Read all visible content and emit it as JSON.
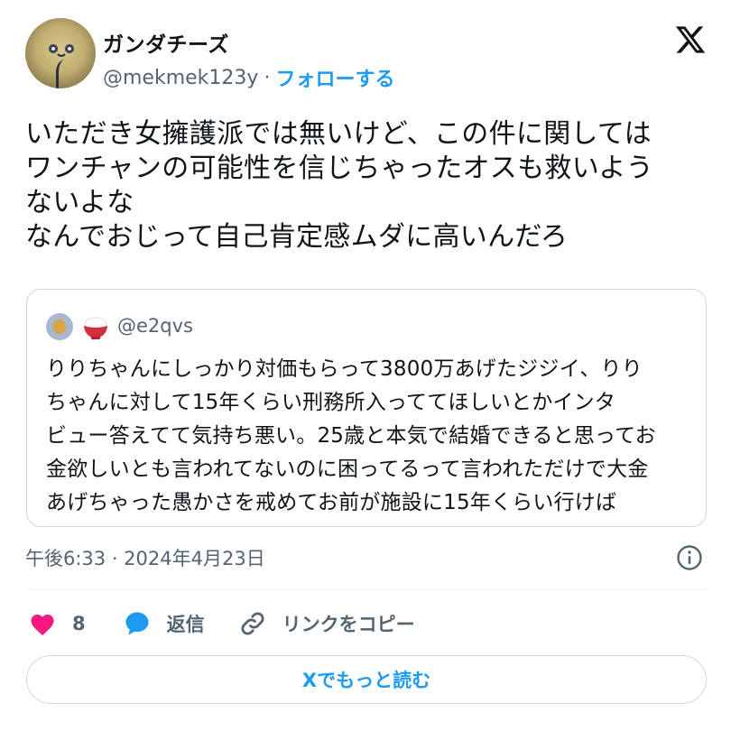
{
  "author": {
    "display_name": "ガンダチーズ",
    "handle": "@mekmek123y",
    "separator": "·",
    "follow_label": "フォローする"
  },
  "tweet": {
    "text": "いただき女擁護派では無いけど、この件に関しては\nワンチャンの可能性を信じちゃったオスも救いよう\nないよな\nなんでおじって自己肯定感ムダに高いんだろ"
  },
  "quote": {
    "handle": "@e2qvs",
    "text": "りりちゃんにしっかり対価もらって3800万あげたジジイ、りり\nちゃんに対して15年くらい刑務所入っててほしいとかインタ\nビュー答えてて気持ち悪い。25歳と本気で結婚できると思ってお\n金欲しいとも言われてないのに困ってるって言われただけで大金\nあげちゃった愚かさを戒めてお前が施設に15年くらい行けば"
  },
  "timestamp": "午後6:33 · 2024年4月23日",
  "actions": {
    "like_count": "8",
    "reply_label": "返信",
    "copy_link_label": "リンクをコピー"
  },
  "read_more_label": "Xでもっと読む",
  "colors": {
    "accent": "#1d9bf0",
    "like": "#f91880",
    "text": "#0f1419",
    "secondary": "#536471",
    "border": "#cfd9de"
  },
  "icons": {
    "brand": "x-logo-icon",
    "info": "info-icon",
    "like": "heart-icon",
    "reply": "speech-bubble-icon",
    "copy": "link-icon"
  }
}
